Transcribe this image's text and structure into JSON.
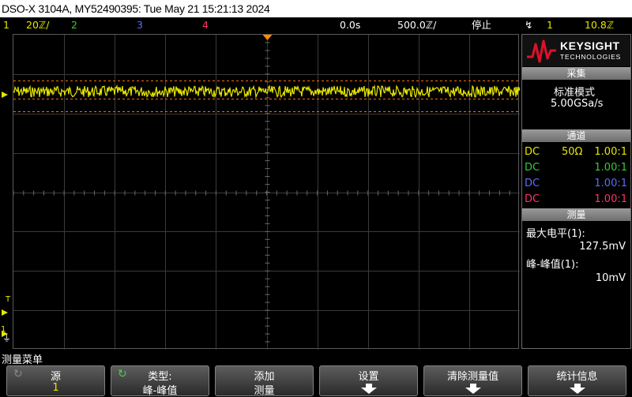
{
  "title": "DSO-X 3104A, MY52490395: Tue May 21 15:21:13 2024",
  "status": {
    "ch1": {
      "num": "1",
      "scale": "20ℤ/",
      "color": "#e6e600"
    },
    "ch2": {
      "num": "2",
      "color": "#33cc33"
    },
    "ch3": {
      "num": "3",
      "color": "#5a6cff"
    },
    "ch4": {
      "num": "4",
      "color": "#ff3366"
    },
    "time_offset": "0.0s",
    "time_scale": "500.0ℤ/",
    "run_state": "停止",
    "trigger_channel": "1",
    "trigger_level": "10.8ℤ"
  },
  "logo": {
    "line1": "KEYSIGHT",
    "line2": "TECHNOLOGIES"
  },
  "acquisition": {
    "header": "采集",
    "mode": "标准模式",
    "rate": "5.00GSa/s"
  },
  "channels": {
    "header": "通道",
    "rows": [
      {
        "coupling": "DC",
        "impedance": "50Ω",
        "probe": "1.00:1",
        "color": "#e6e600"
      },
      {
        "coupling": "DC",
        "impedance": "",
        "probe": "1.00:1",
        "color": "#33cc33"
      },
      {
        "coupling": "DC",
        "impedance": "",
        "probe": "1.00:1",
        "color": "#5a6cff"
      },
      {
        "coupling": "DC",
        "impedance": "",
        "probe": "1.00:1",
        "color": "#ff3366"
      }
    ]
  },
  "measure": {
    "header": "测量",
    "m1_label": "最大电平(1):",
    "m1_value": "127.5mV",
    "m2_label": "峰-峰值(1):",
    "m2_value": "10mV"
  },
  "menu": {
    "title": "测量菜单",
    "keys": [
      {
        "l1": "源",
        "l2": "1"
      },
      {
        "l1": "类型:",
        "l2": "峰-峰值"
      },
      {
        "l1": "添加",
        "l2": "测量"
      },
      {
        "l1": "设置",
        "l2": ""
      },
      {
        "l1": "清除测量值",
        "l2": ""
      },
      {
        "l1": "统计信息",
        "l2": ""
      }
    ]
  },
  "markers": {
    "trigger": "T",
    "ground": "1"
  }
}
